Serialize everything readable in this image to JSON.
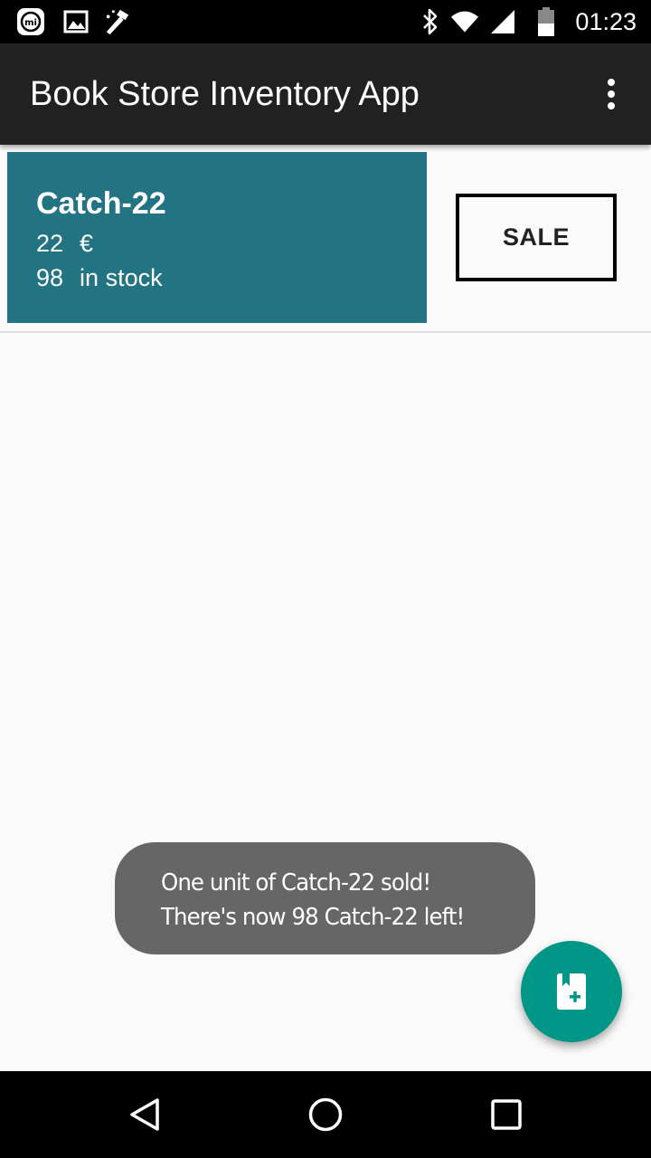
{
  "status_bar": {
    "time": "01:23",
    "icons": [
      "mi-icon",
      "image-icon",
      "wand-icon",
      "bluetooth-icon",
      "wifi-icon",
      "signal-icon",
      "battery-icon"
    ]
  },
  "app_bar": {
    "title": "Book Store Inventory App",
    "overflow_icon": "more-vert-icon"
  },
  "books": [
    {
      "title": "Catch-22",
      "price": "22",
      "currency": "€",
      "stock": "98",
      "stock_suffix": "in stock",
      "sale_label": "SALE"
    }
  ],
  "toast": {
    "line1": "One unit of Catch-22 sold!",
    "line2": "There's now 98 Catch-22 left!"
  },
  "fab": {
    "icon": "add-book-icon"
  },
  "nav_bar": {
    "icons": [
      "back-icon",
      "home-icon",
      "recents-icon"
    ]
  },
  "colors": {
    "app_bar": "#212121",
    "card": "#227483",
    "fab": "#009688",
    "toast": "#666666"
  }
}
